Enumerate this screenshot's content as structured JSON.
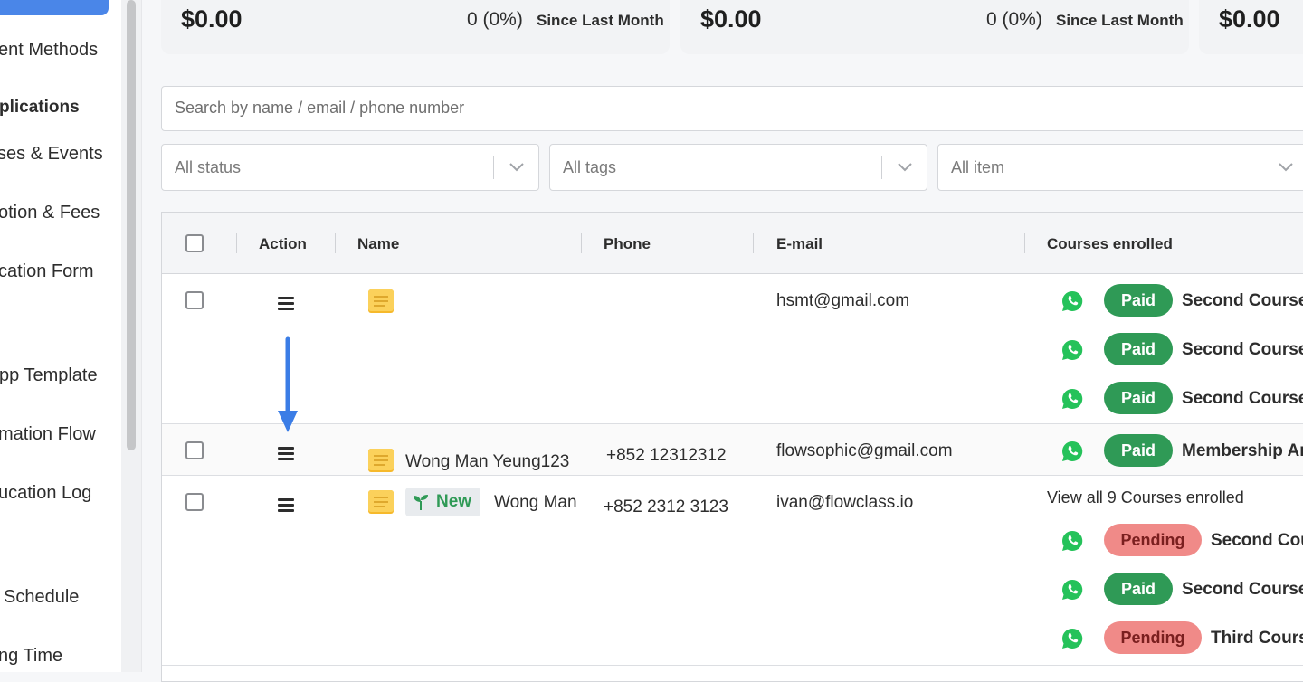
{
  "sidebar": {
    "items": [
      {
        "label": "ent Methods",
        "type": "item"
      },
      {
        "label": "plications",
        "type": "section"
      },
      {
        "label": "ses & Events",
        "type": "item"
      },
      {
        "label": "otion & Fees",
        "type": "item"
      },
      {
        "label": "cation Form",
        "type": "item"
      },
      {
        "label": "pp Template",
        "type": "item"
      },
      {
        "label": "mation Flow",
        "type": "item"
      },
      {
        "label": "ucation Log",
        "type": "item"
      },
      {
        "label": "Schedule",
        "type": "item"
      },
      {
        "label": "ng Time",
        "type": "item"
      }
    ]
  },
  "stats": [
    {
      "amount": "$0.00",
      "change": "0 (0%)",
      "since": "Since Last Month"
    },
    {
      "amount": "$0.00",
      "change": "0 (0%)",
      "since": "Since Last Month"
    },
    {
      "amount": "$0.00"
    }
  ],
  "search": {
    "placeholder": "Search by name / email / phone number"
  },
  "filters": {
    "status": "All status",
    "tags": "All tags",
    "item": "All item"
  },
  "table": {
    "headers": {
      "action": "Action",
      "name": "Name",
      "phone": "Phone",
      "email": "E-mail",
      "courses": "Courses enrolled"
    },
    "rows": [
      {
        "name": "",
        "phone": "",
        "email": "hsmt@gmail.com",
        "courses": [
          {
            "status": "Paid",
            "name": "Second Course"
          },
          {
            "status": "Paid",
            "name": "Second Course"
          },
          {
            "status": "Paid",
            "name": "Second Course"
          }
        ]
      },
      {
        "name": "Wong Man Yeung123",
        "phone": "+852 12312312",
        "email": "flowsophic@gmail.com",
        "courses": [
          {
            "status": "Paid",
            "name": "Membership  Ar"
          }
        ]
      },
      {
        "tag": "New",
        "name": "Wong Man",
        "phone": "+852 2312 3123",
        "email": "ivan@flowclass.io",
        "view_all": "View all 9 Courses enrolled",
        "courses": [
          {
            "status": "Pending",
            "name": "Second Cour"
          },
          {
            "status": "Paid",
            "name": "Second Course"
          },
          {
            "status": "Pending",
            "name": "Third Course"
          }
        ]
      }
    ]
  },
  "colors": {
    "paid": "#2f9a56",
    "pending": "#f08a88",
    "accent": "#4a86e8",
    "whatsapp": "#25c25a"
  }
}
